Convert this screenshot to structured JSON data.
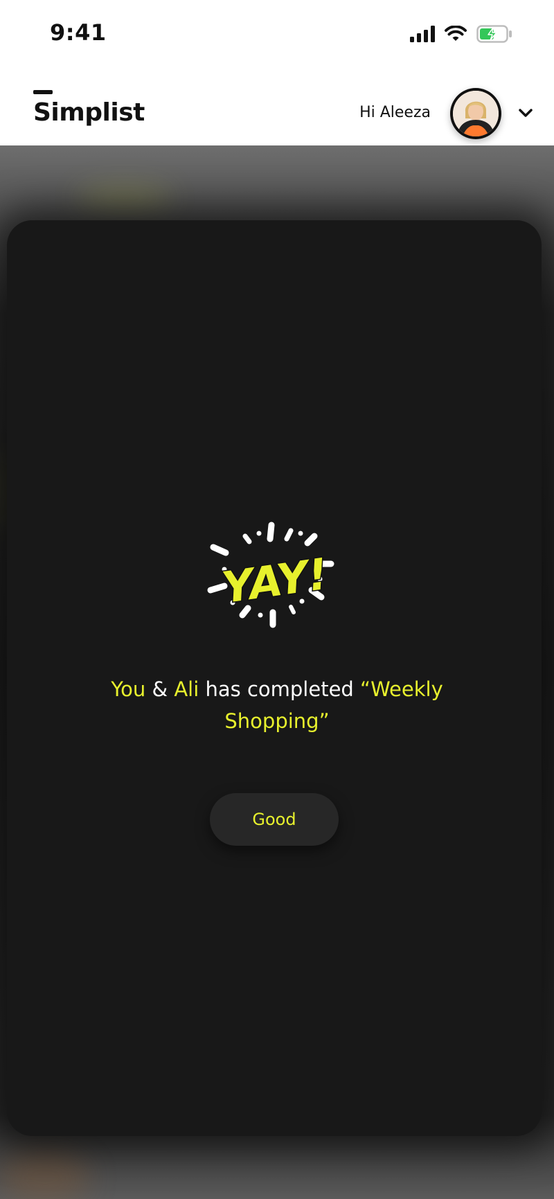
{
  "status_bar": {
    "time": "9:41",
    "icons": [
      "cellular-signal-icon",
      "wifi-icon",
      "battery-charging-icon"
    ],
    "battery_color": "#34c759"
  },
  "header": {
    "logo": "Simplist",
    "greeting": "Hi Aleeza",
    "avatar_icon": "user-avatar",
    "menu_icon": "chevron-down-icon"
  },
  "modal": {
    "illustration_text": "YAY!",
    "message": {
      "part1": "You",
      "part2": " & ",
      "part3": "Ali",
      "part4": " has completed ",
      "part5": "“Weekly Shopping”"
    },
    "button_label": "Good"
  },
  "colors": {
    "accent": "#e7f02d",
    "card": "#181818",
    "button": "#272727",
    "text_dark": "#111111"
  }
}
